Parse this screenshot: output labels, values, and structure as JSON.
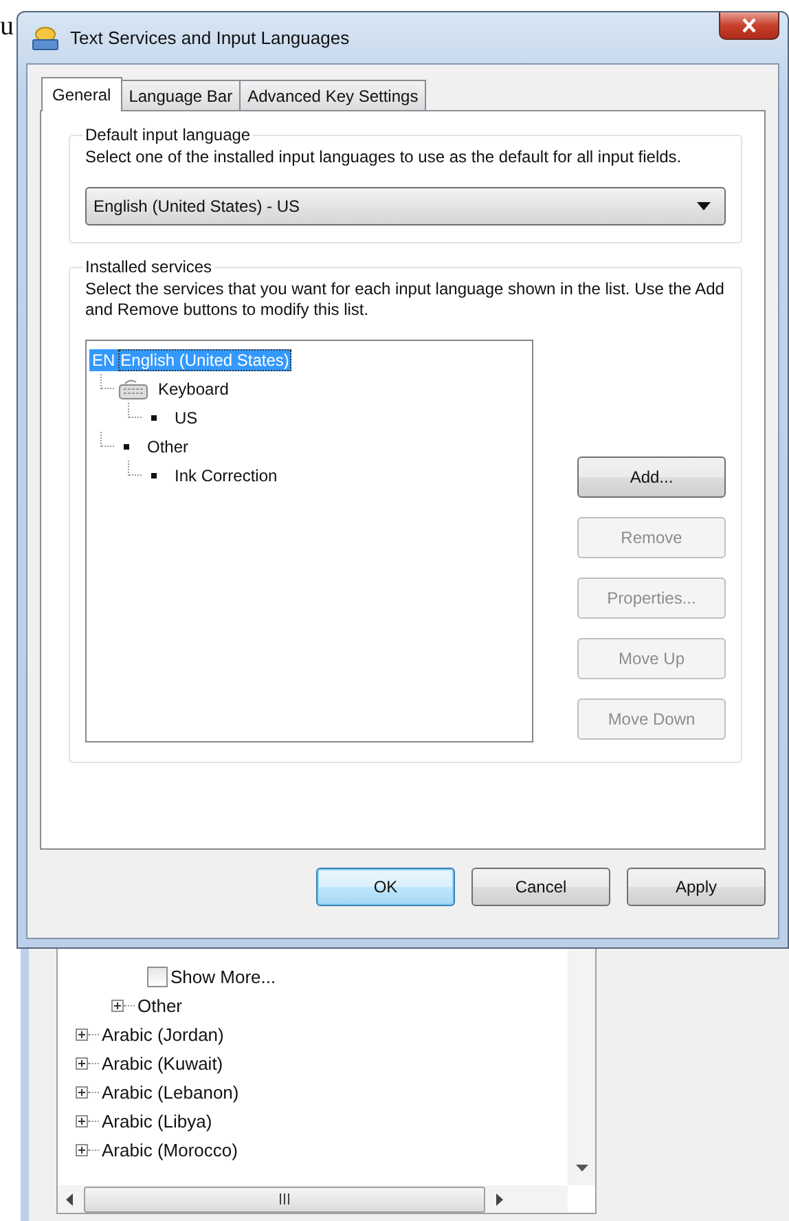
{
  "stray_text": "u",
  "window": {
    "title": "Text Services and Input Languages"
  },
  "tabs": [
    {
      "label": "General",
      "selected": true
    },
    {
      "label": "Language Bar",
      "selected": false
    },
    {
      "label": "Advanced Key Settings",
      "selected": false
    }
  ],
  "default_input_language": {
    "title": "Default input language",
    "description": "Select one of the installed input languages to use as the default for all input fields.",
    "dropdown": {
      "value": "English (United States) - US"
    }
  },
  "installed_services": {
    "title": "Installed services",
    "description": "Select the services that you want for each input language shown in the list. Use the Add and Remove buttons to modify this list.",
    "tree": [
      {
        "kind": "language",
        "badge": "EN",
        "label": "English (United States)",
        "selected": true,
        "children": [
          {
            "kind": "keyboard",
            "label": "Keyboard",
            "selected": false,
            "children": [
              {
                "kind": "bullet",
                "label": "US",
                "selected": false
              }
            ]
          },
          {
            "kind": "bullet",
            "label": "Other",
            "selected": false,
            "children": [
              {
                "kind": "bullet",
                "label": "Ink Correction",
                "selected": false
              }
            ]
          }
        ]
      }
    ],
    "buttons": [
      {
        "label": "Add...",
        "disabled": false
      },
      {
        "label": "Remove",
        "disabled": true
      },
      {
        "label": "Properties...",
        "disabled": true
      },
      {
        "label": "Move Up",
        "disabled": true
      },
      {
        "label": "Move Down",
        "disabled": true
      }
    ]
  },
  "dialog_buttons": [
    {
      "label": "OK",
      "default": true
    },
    {
      "label": "Cancel",
      "default": false
    },
    {
      "label": "Apply",
      "default": false
    }
  ],
  "background_window": {
    "tree": [
      {
        "children": [
          {
            "children": [
              {
                "kind": "checkbox",
                "label": "Show More...",
                "checked": false
              }
            ]
          },
          {
            "kind": "expander",
            "label": "Other",
            "expanded": false
          }
        ]
      },
      {
        "kind": "expander",
        "label": "Arabic (Jordan)",
        "expanded": false
      },
      {
        "kind": "expander",
        "label": "Arabic (Kuwait)",
        "expanded": false
      },
      {
        "kind": "expander",
        "label": "Arabic (Lebanon)",
        "expanded": false
      },
      {
        "kind": "expander",
        "label": "Arabic (Libya)",
        "expanded": false
      },
      {
        "kind": "expander",
        "label": "Arabic (Morocco)",
        "expanded": false
      }
    ]
  }
}
